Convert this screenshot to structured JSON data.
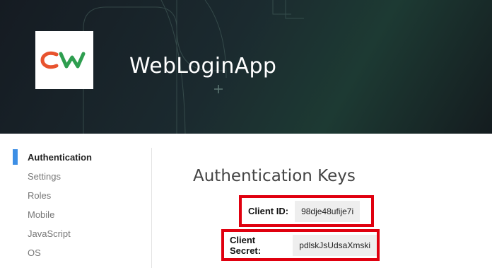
{
  "header": {
    "app_title": "WebLoginApp",
    "logo": {
      "icon": "cw-logo-icon",
      "letters": "CW",
      "colors": {
        "c": "#e8532e",
        "w": "#2e9e4f"
      }
    }
  },
  "sidebar": {
    "items": [
      {
        "label": "Authentication",
        "active": true
      },
      {
        "label": "Settings"
      },
      {
        "label": "Roles"
      },
      {
        "label": "Mobile"
      },
      {
        "label": "JavaScript"
      },
      {
        "label": "OS"
      }
    ],
    "accent_color": "#3d8fe5"
  },
  "main": {
    "title": "Authentication Keys",
    "client_id": {
      "label": "Client ID:",
      "value": "98dje48ufije7i"
    },
    "client_secret": {
      "label": "Client Secret:",
      "value": "pdlskJsUdsaXmski"
    },
    "highlight_color": "#e0000f"
  }
}
